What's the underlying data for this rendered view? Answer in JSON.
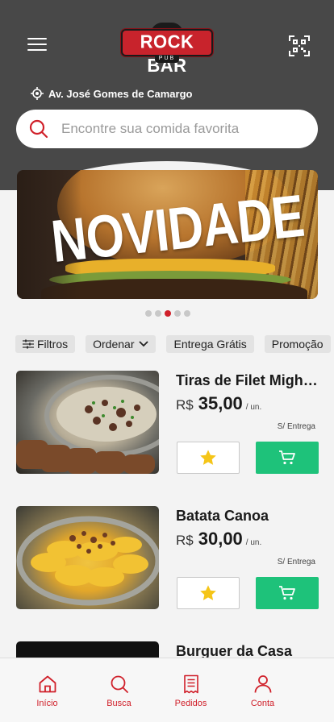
{
  "header": {
    "brand_main": "ROCK BAR",
    "brand_sub": "PUB",
    "address": "Av. José Gomes de Camargo"
  },
  "search": {
    "placeholder": "Encontre sua comida favorita"
  },
  "banner": {
    "headline": "NOVIDADE",
    "slide_count": 5,
    "active_slide": 3
  },
  "filters": [
    {
      "label": "Filtros",
      "icon": "sliders-icon"
    },
    {
      "label": "Ordenar",
      "icon": "chevron-down-icon"
    },
    {
      "label": "Entrega Grátis"
    },
    {
      "label": "Promoção"
    }
  ],
  "products": [
    {
      "name": "Tiras de Filet Mighon",
      "currency": "R$",
      "price": "35,00",
      "unit": "/ un.",
      "delivery": "S/ Entrega"
    },
    {
      "name": "Batata Canoa",
      "currency": "R$",
      "price": "30,00",
      "unit": "/ un.",
      "delivery": "S/ Entrega"
    },
    {
      "name": "Burguer da Casa"
    }
  ],
  "nav": [
    {
      "label": "Início",
      "icon": "home-icon"
    },
    {
      "label": "Busca",
      "icon": "search-icon"
    },
    {
      "label": "Pedidos",
      "icon": "receipt-icon"
    },
    {
      "label": "Conta",
      "icon": "user-icon"
    }
  ],
  "colors": {
    "header": "#484848",
    "brand_red": "#d0202a",
    "cart_green": "#1ec27a",
    "star": "#f5c518"
  }
}
